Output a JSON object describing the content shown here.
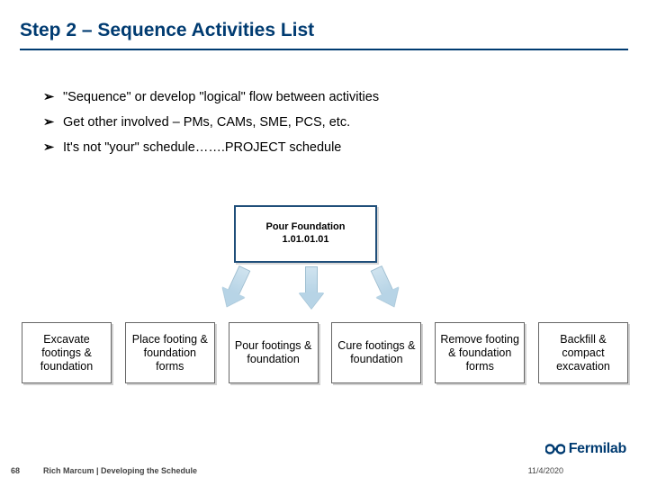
{
  "title": "Step 2 – Sequence Activities List",
  "bullets": [
    "\"Sequence\" or develop \"logical\" flow between activities",
    "Get other involved – PMs, CAMs, SME, PCS, etc.",
    "It's not \"your\" schedule…….PROJECT schedule"
  ],
  "topbox": {
    "title": "Pour Foundation",
    "code": "1.01.01.01"
  },
  "boxes": [
    "Excavate footings & foundation",
    "Place footing & foundation forms",
    "Pour footings & foundation",
    "Cure footings & foundation",
    "Remove footing & foundation forms",
    "Backfill & compact excavation"
  ],
  "footer": {
    "page": "68",
    "text": "Rich Marcum | Developing the Schedule",
    "date": "11/4/2020"
  },
  "brand": "Fermilab"
}
